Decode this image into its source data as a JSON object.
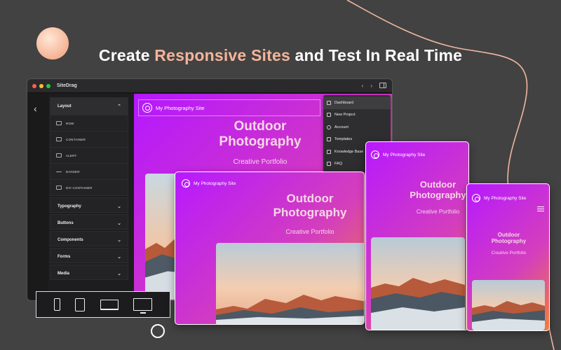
{
  "headline": {
    "prefix": "Create ",
    "accent": "Responsive Sites",
    "suffix": " and Test In Real Time"
  },
  "colors": {
    "accent": "#f5b49a",
    "gradient_start": "#b418ff",
    "gradient_end": "#f0763f",
    "background": "#424242"
  },
  "window": {
    "title": "SiteDrag",
    "nav_back_icon": "chevron-left-icon",
    "nav_forward_icon": "chevron-right-icon",
    "sidebar_icon": "sidebar-toggle-icon"
  },
  "panel": {
    "layout_section": {
      "label": "Layout",
      "items": [
        {
          "label": "ROW",
          "icon": "row-icon"
        },
        {
          "label": "CONTAINER",
          "icon": "container-icon"
        },
        {
          "label": "ALERT",
          "icon": "alert-icon"
        },
        {
          "label": "DIVIDER",
          "icon": "divider-icon"
        },
        {
          "label": "DIV CONTAINER",
          "icon": "div-container-icon"
        }
      ]
    },
    "sections": [
      "Typography",
      "Buttons",
      "Components",
      "Forms",
      "Media"
    ]
  },
  "site": {
    "brand": "My Photography Site",
    "hero_title_line1": "Outdoor",
    "hero_title_line2": "Photography",
    "hero_subtitle": "Creative Portfolio"
  },
  "menu": {
    "items": [
      {
        "label": "Dashboard",
        "icon": "home-icon"
      },
      {
        "label": "New Project",
        "icon": "document-icon"
      },
      {
        "label": "Account",
        "icon": "user-icon"
      },
      {
        "label": "Templates",
        "icon": "templates-icon"
      },
      {
        "label": "Knowledge Base",
        "icon": "book-icon"
      },
      {
        "label": "FAQ",
        "icon": "faq-icon"
      }
    ]
  },
  "devices": [
    "phone-icon",
    "tablet-icon",
    "laptop-icon",
    "desktop-icon"
  ]
}
